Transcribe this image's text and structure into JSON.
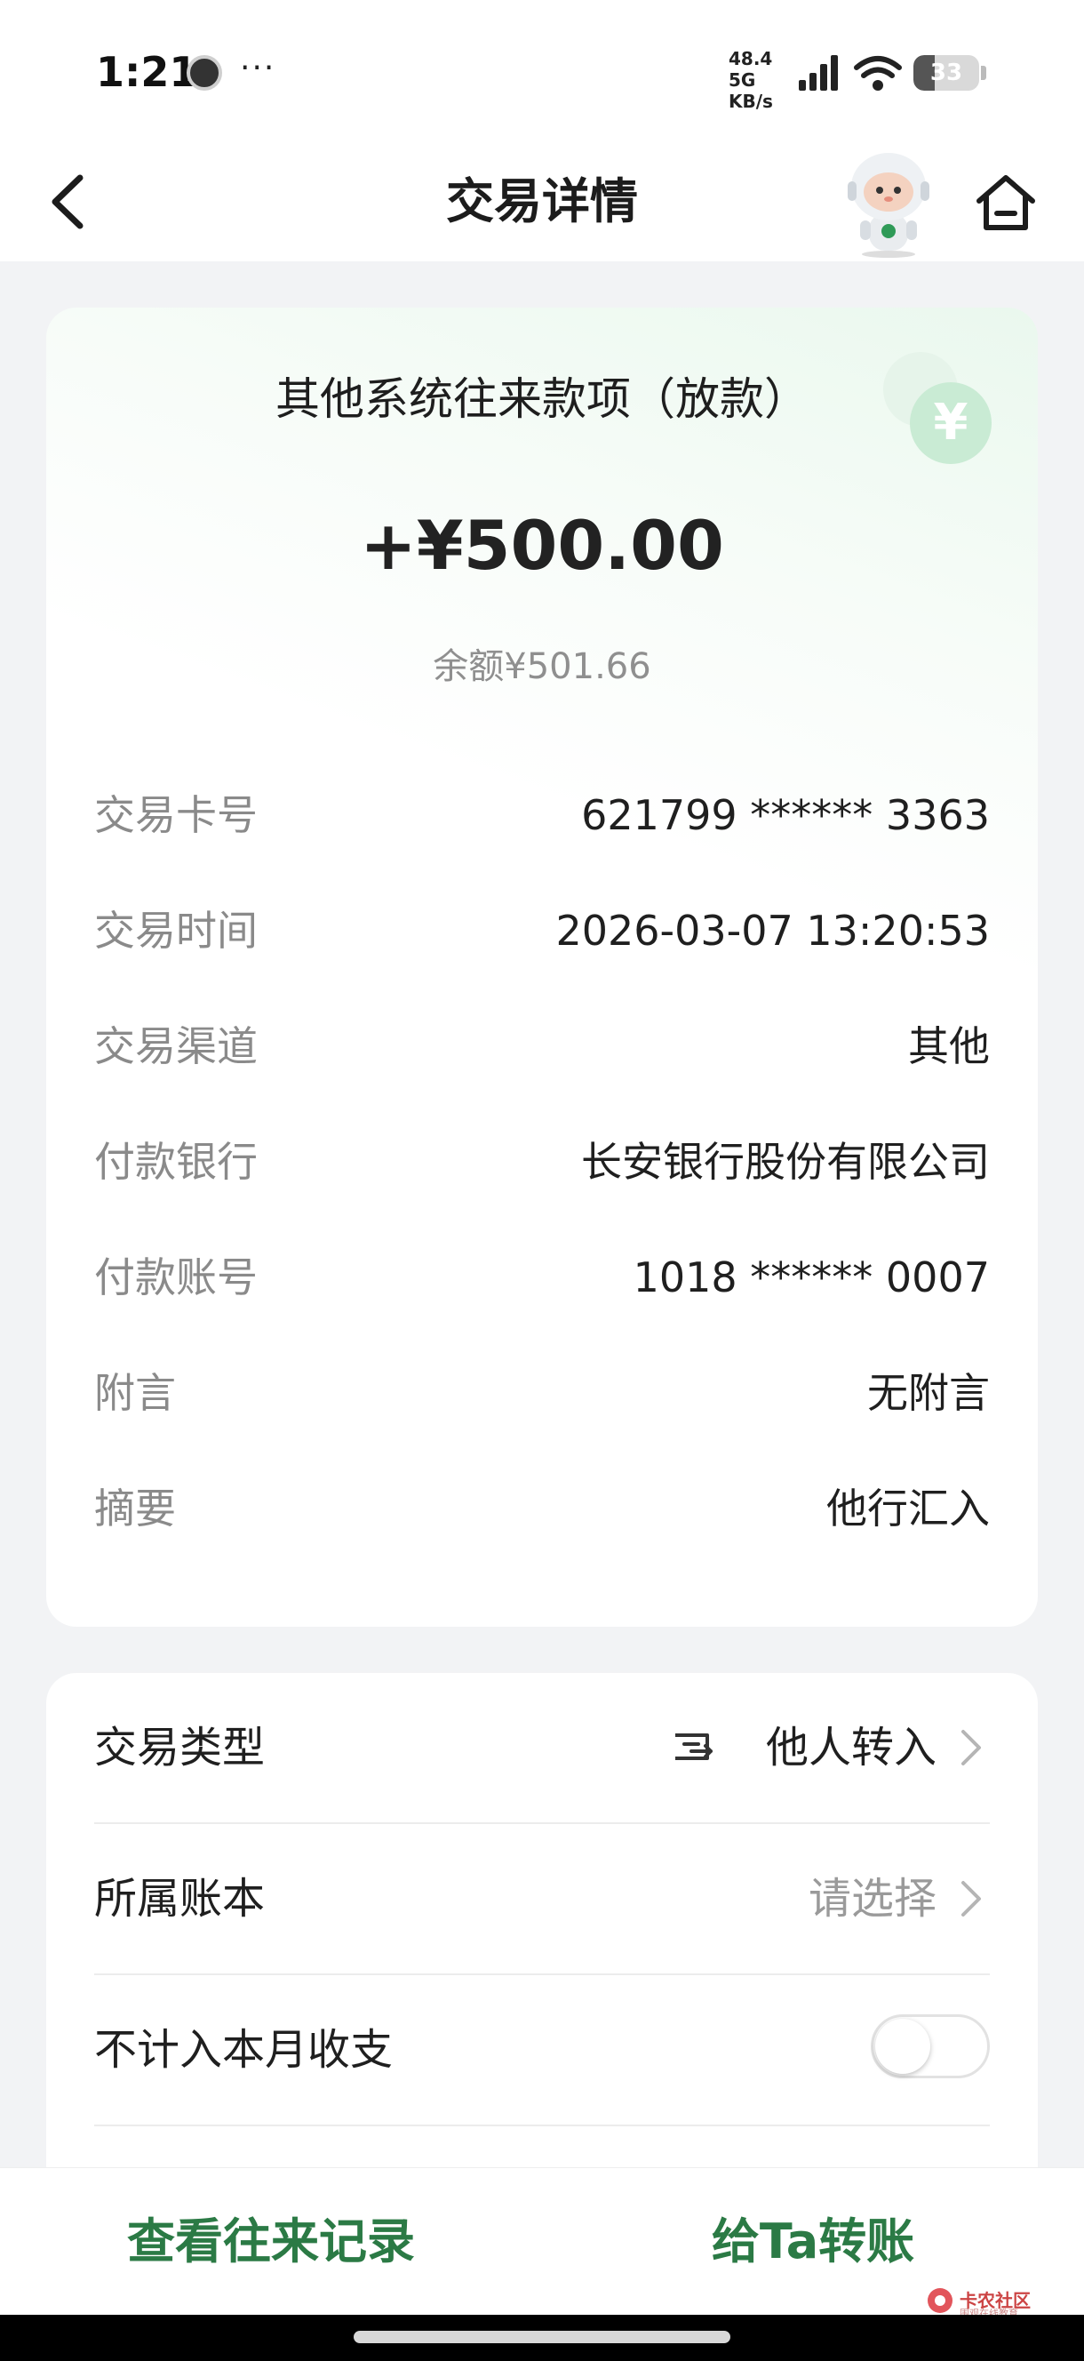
{
  "status_bar": {
    "time": "1:21",
    "dots": "···",
    "network_speed_value": "48.4",
    "network_speed_unit": "KB/s",
    "network_type": "5G",
    "battery": "33",
    "battery_level": 0.33
  },
  "header": {
    "title": "交易详情"
  },
  "transaction": {
    "title": "其他系统往来款项（放款）",
    "amount": "+¥500.00",
    "balance": "余额¥501.66",
    "coin_symbol": "¥",
    "details": [
      {
        "label": "交易卡号",
        "value": "621799 ****** 3363"
      },
      {
        "label": "交易时间",
        "value": "2026-03-07 13:20:53"
      },
      {
        "label": "交易渠道",
        "value": "其他"
      },
      {
        "label": "付款银行",
        "value": "长安银行股份有限公司"
      },
      {
        "label": "付款账号",
        "value": "1018 ****** 0007"
      },
      {
        "label": "附言",
        "value": "无附言"
      },
      {
        "label": "摘要",
        "value": "他行汇入"
      }
    ]
  },
  "settings": {
    "transaction_type_label": "交易类型",
    "transaction_type_value": "他人转入",
    "ledger_label": "所属账本",
    "ledger_placeholder": "请选择",
    "exclude_label": "不计入本月收支",
    "exclude_enabled": false
  },
  "bottom": {
    "records_button": "查看往来记录",
    "transfer_button": "给Ta转账"
  },
  "watermark": {
    "text": "卡农社区",
    "subtext": "围观在线教育"
  },
  "colors": {
    "accent_green": "#2b7a45",
    "coin_green": "#c9ebd4",
    "muted_text": "#8a8a8a"
  }
}
